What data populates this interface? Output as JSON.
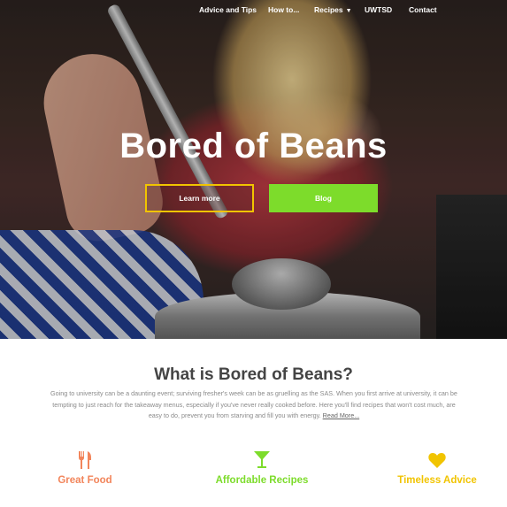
{
  "nav": {
    "items": [
      {
        "label": "Advice and Tips"
      },
      {
        "label": "How to..."
      },
      {
        "label": "Recipes"
      },
      {
        "label": "UWTSD"
      },
      {
        "label": "Contact"
      }
    ]
  },
  "hero": {
    "title": "Bored of Beans",
    "learn_more": "Learn more",
    "blog": "Blog"
  },
  "about": {
    "title": "What is Bored of Beans?",
    "text": "Going to university can be a daunting event; surviving fresher's week can be as gruelling as the SAS. When you first arrive at university, it can be tempting to just reach for the takeaway menus, especially if you've never really cooked before. Here you'll find recipes that won't cost much, are easy to do, prevent you from starving and fill you with energy.",
    "read_more": "Read More..."
  },
  "features": [
    {
      "label": "Great Food",
      "icon": "fork-knife-icon",
      "color": "#f2855b"
    },
    {
      "label": "Affordable Recipes",
      "icon": "cocktail-glass-icon",
      "color": "#7ddc2b"
    },
    {
      "label": "Timeless Advice",
      "icon": "heart-icon",
      "color": "#f1c400"
    }
  ],
  "colors": {
    "accent_green": "#7ddc2b",
    "accent_yellow": "#f1c400",
    "accent_orange": "#f2855b"
  }
}
